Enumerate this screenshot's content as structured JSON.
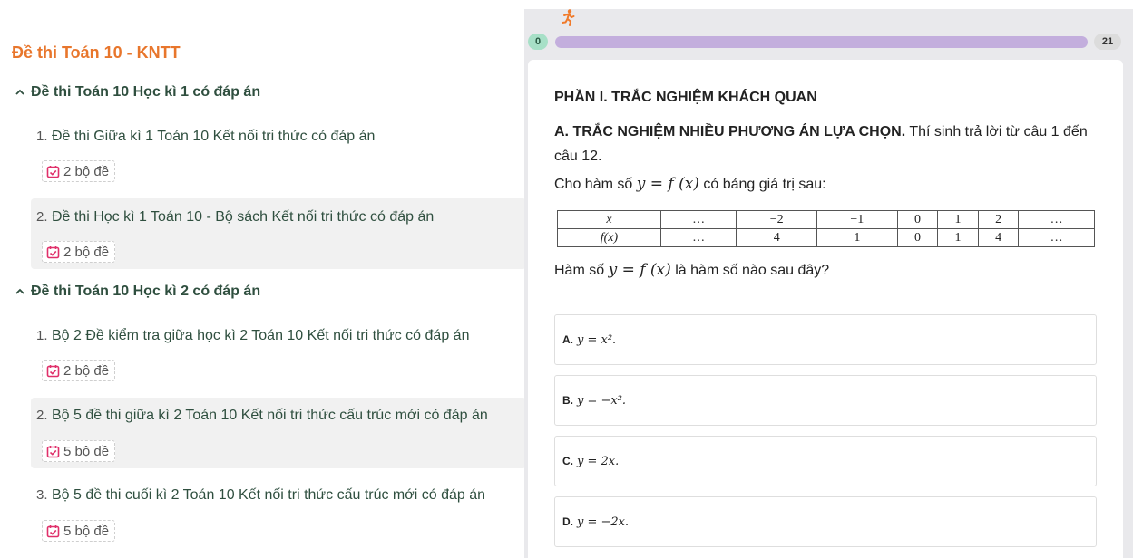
{
  "sidebar": {
    "title": "Đề thi Toán 10 - KNTT",
    "groups": [
      {
        "label": "Đề thi Toán 10 Học kì 1 có đáp án",
        "items": [
          {
            "num": "1.",
            "title": "Đề thi Giữa kì 1 Toán 10 Kết nối tri thức có đáp án",
            "badge": "2 bộ đề"
          },
          {
            "num": "2.",
            "title": "Đề thi Học kì 1 Toán 10 - Bộ sách Kết nối tri thức có đáp án",
            "badge": "2 bộ đề"
          }
        ]
      },
      {
        "label": "Đề thi Toán 10 Học kì 2 có đáp án",
        "items": [
          {
            "num": "1.",
            "title": "Bộ 2 Đề kiểm tra giữa học kì 2 Toán 10 Kết nối tri thức có đáp án",
            "badge": "2 bộ đề"
          },
          {
            "num": "2.",
            "title": "Bộ 5 đề thi giữa kì 2 Toán 10 Kết nối tri thức cấu trúc mới có đáp án",
            "badge": "5 bộ đề"
          },
          {
            "num": "3.",
            "title": "Bộ 5 đề thi cuối kì 2 Toán 10 Kết nối tri thức cấu trúc mới có đáp án",
            "badge": "5 bộ đề"
          }
        ]
      }
    ]
  },
  "progress": {
    "start": "0",
    "end": "21",
    "runner_icon": "running-person-icon",
    "fill_fraction": 1.0
  },
  "question": {
    "section": "PHẦN I. TRẮC NGHIỆM KHÁCH QUAN",
    "part_bold": "A. TRẮC NGHIỆM NHIỀU PHƯƠNG ÁN LỰA CHỌN.",
    "part_rest": " Thí sinh trả lời từ câu 1 đến câu 12.",
    "intro_pre": "Cho hàm số ",
    "intro_math": "y = f (x)",
    "intro_post": " có bảng giá trị sau:",
    "table": {
      "row1": [
        "x",
        "…",
        "−2",
        "−1",
        "0",
        "1",
        "2",
        "…"
      ],
      "row2": [
        "f(x)",
        "…",
        "4",
        "1",
        "0",
        "1",
        "4",
        "…"
      ]
    },
    "ask_pre": "Hàm số ",
    "ask_math": "y = f (x)",
    "ask_post": " là hàm số nào sau đây?",
    "options": [
      {
        "label": "A.",
        "expr": "y = x²."
      },
      {
        "label": "B.",
        "expr": "y = −x²."
      },
      {
        "label": "C.",
        "expr": "y = 2x."
      },
      {
        "label": "D.",
        "expr": "y = −2x."
      }
    ]
  },
  "colors": {
    "accent_orange": "#e8762c",
    "heading_green": "#2f4f3f",
    "badge_icon": "#e0306a",
    "progress_fill": "#c3aedd",
    "progress_start": "#a7e0c7"
  }
}
